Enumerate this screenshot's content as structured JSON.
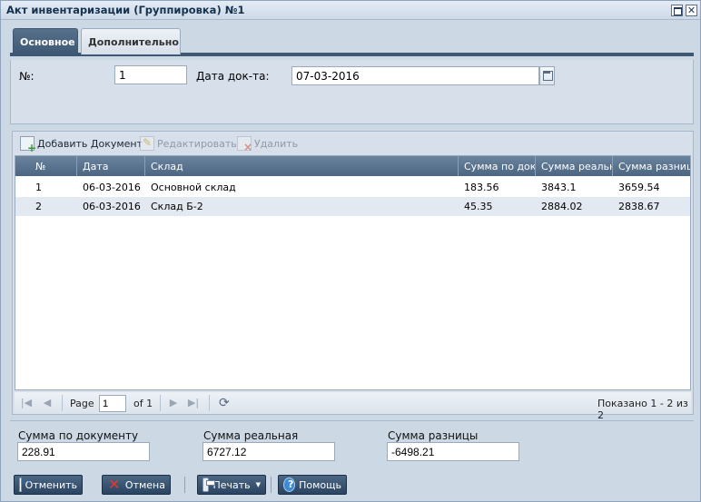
{
  "window": {
    "title": "Акт инвентаризации (Группировка) №1"
  },
  "tabs": [
    {
      "label": "Основное",
      "active": true
    },
    {
      "label": "Дополнительно",
      "active": false
    }
  ],
  "form": {
    "number_label": "№:",
    "number_value": "1",
    "date_label": "Дата док-та:",
    "date_value": "07-03-2016"
  },
  "toolbar": {
    "add_label": "Добавить Документ",
    "edit_label": "Редактировать",
    "delete_label": "Удалить"
  },
  "grid": {
    "columns": [
      "№",
      "Дата",
      "Склад",
      "Сумма по документу",
      "Сумма реальная",
      "Сумма разницы"
    ],
    "rows": [
      [
        "1",
        "06-03-2016",
        "Основной склад",
        "183.56",
        "3843.1",
        "3659.54"
      ],
      [
        "2",
        "06-03-2016",
        "Склад Б-2",
        "45.35",
        "2884.02",
        "2838.67"
      ]
    ]
  },
  "pager": {
    "page_label": "Page",
    "page_value": "1",
    "of_label": "of 1",
    "display_info": "Показано 1 - 2 из 2"
  },
  "totals": {
    "doc_sum_label": "Сумма по документу",
    "doc_sum_value": "228.91",
    "real_sum_label": "Сумма реальная",
    "real_sum_value": "6727.12",
    "diff_sum_label": "Сумма разницы",
    "diff_sum_value": "-6498.21"
  },
  "buttons": {
    "revert": "Отменить",
    "cancel": "Отмена",
    "print": "Печать",
    "help": "Помощь"
  }
}
